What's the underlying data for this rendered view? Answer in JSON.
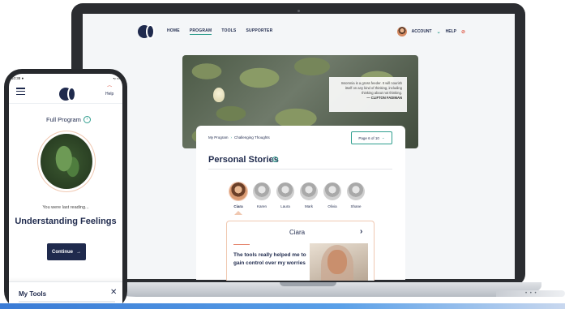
{
  "site": {
    "nav": [
      "HOME",
      "PROGRAM",
      "TOOLS",
      "SUPPORTER"
    ],
    "active_nav": "PROGRAM",
    "account_label": "ACCOUNT",
    "help_label": "HELP"
  },
  "hero": {
    "quote": "Insomnia is a gross feeder. It will nourish itself on any kind of thinking, including thinking about not thinking.",
    "author": "— CLIFTON FADIMAN"
  },
  "breadcrumb": {
    "root": "My Program",
    "current": "Challenging Thoughts"
  },
  "pager": {
    "label": "Page 6 of 10"
  },
  "section": {
    "title": "Personal Stories"
  },
  "people": [
    {
      "name": "Ciara",
      "selected": true
    },
    {
      "name": "Karen"
    },
    {
      "name": "Laura"
    },
    {
      "name": "Mark"
    },
    {
      "name": "Olivia"
    },
    {
      "name": "Shane"
    }
  ],
  "story": {
    "name": "Ciara",
    "text": "The tools really helped me to gain control over my worries"
  },
  "phone": {
    "time": "10:38 ●",
    "signal": "▪ᵢₗ ▭",
    "help_label": "Help",
    "full_program": "Full Program",
    "last_reading": "You were last reading...",
    "topic": "Understanding Feelings",
    "continue_label": "Continue",
    "tools_label": "My Tools",
    "close_glyph": "✕"
  },
  "colors": {
    "navy": "#1f2a4d",
    "teal": "#2f9e8e",
    "coral": "#e5876f"
  }
}
